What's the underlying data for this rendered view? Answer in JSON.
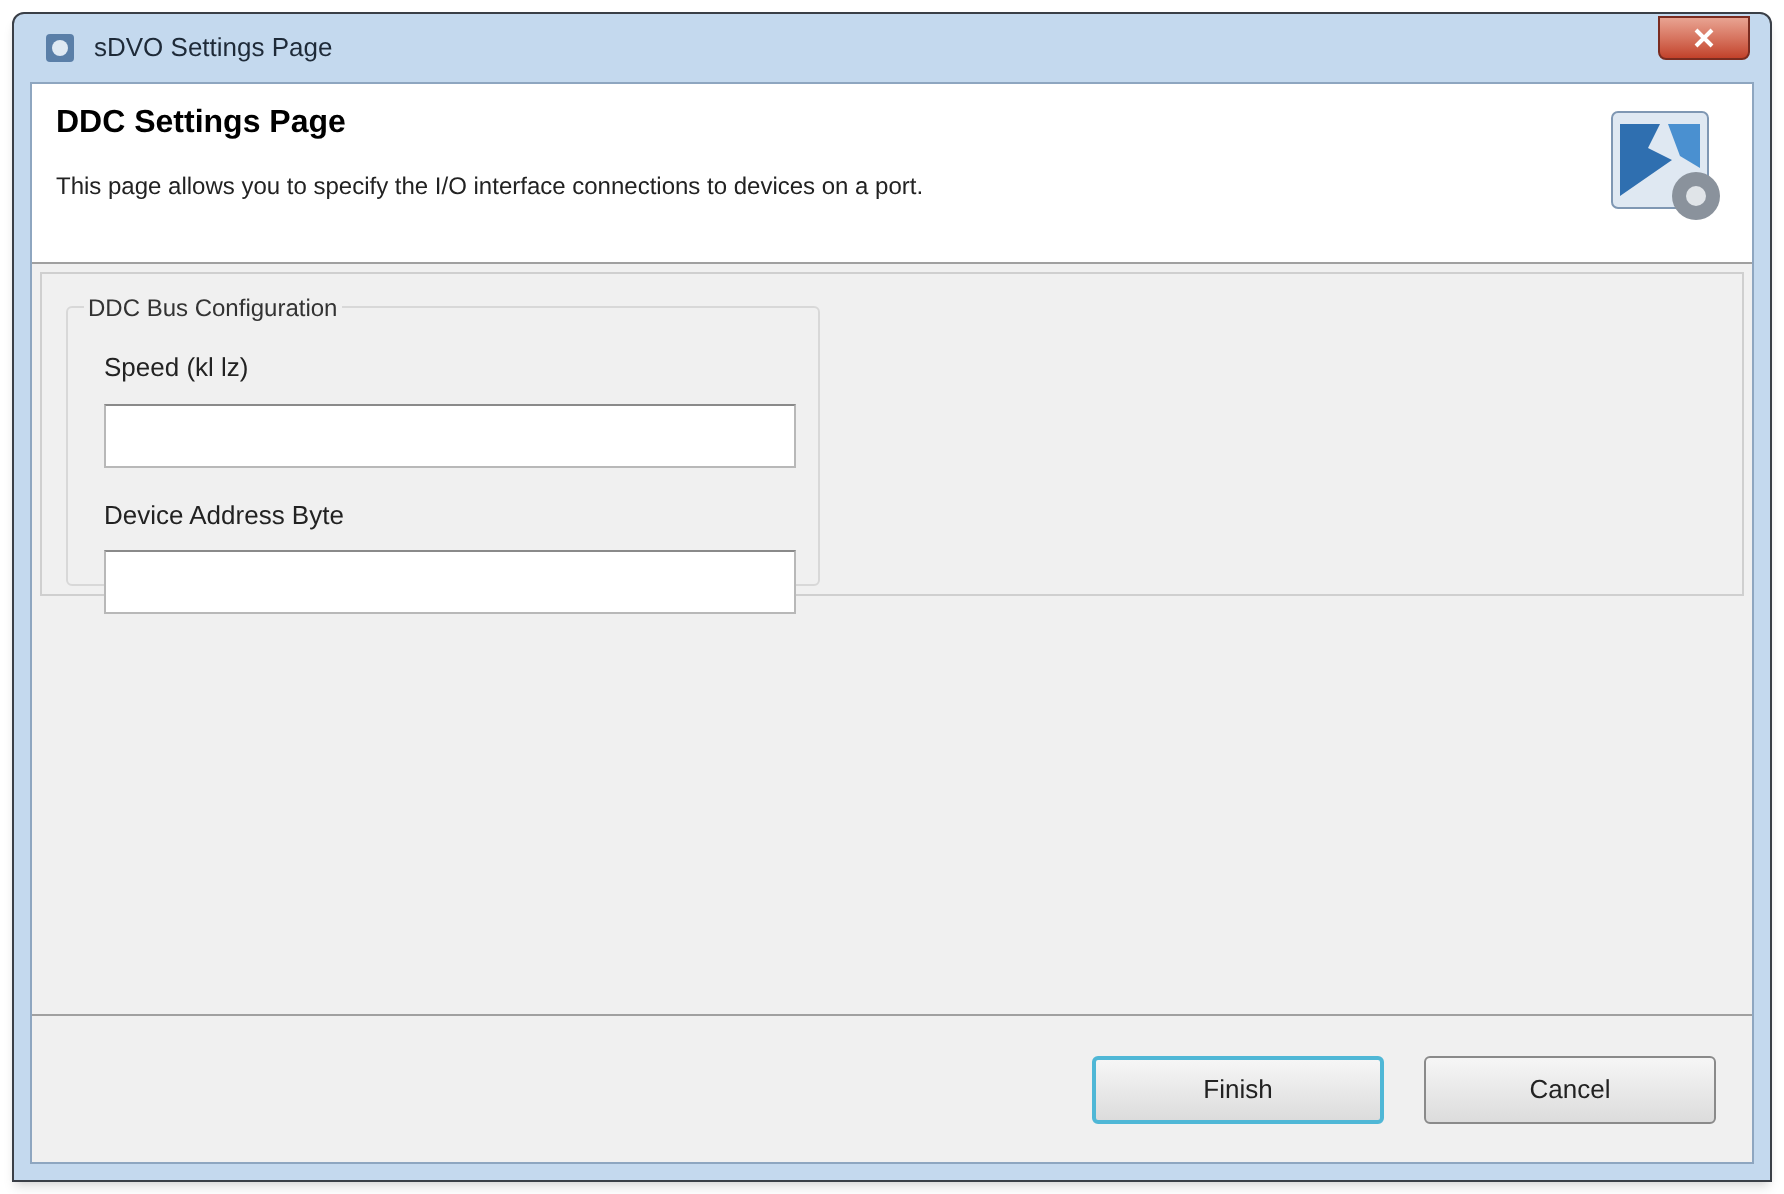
{
  "window": {
    "title": "sDVO Settings Page"
  },
  "header": {
    "title": "DDC Settings Page",
    "description": "This page allows you to specify the I/O interface connections to devices on a port."
  },
  "group": {
    "title": "DDC Bus Configuration",
    "fields": [
      {
        "label": "Speed (kl lz)"
      },
      {
        "label": "Device Address Byte"
      }
    ]
  },
  "buttons": [
    {
      "label": "Finish",
      "default": true
    },
    {
      "label": "Cancel",
      "default": false
    }
  ]
}
